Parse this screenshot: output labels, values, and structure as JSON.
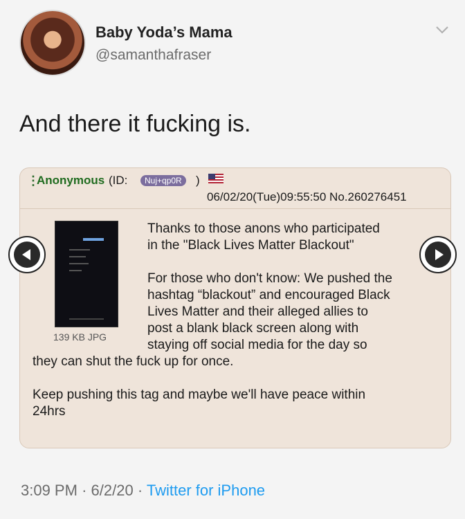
{
  "tweet": {
    "display_name": "Baby Yoda’s Mama",
    "handle": "@samanthafraser",
    "text": "And there it fucking is.",
    "time": "3:09 PM",
    "date": "6/2/20",
    "sep": "·",
    "source": "Twitter for iPhone",
    "chevron_icon": "chevron-down-icon",
    "avatar_icon": "profile-photo"
  },
  "post": {
    "author": "Anonymous",
    "id_label": "(ID:",
    "id_value": "Nuj+qp0R",
    "id_close": ")",
    "flag_icon": "us-flag-icon",
    "timestamp": "06/02/20(Tue)09:55:50 No.260276451",
    "file_info": "139 KB JPG",
    "paragraph1_line1": "Thanks to those anons who participated",
    "paragraph1_line2": "in the \"Black Lives Matter Blackout\"",
    "paragraph2_line1": "For those who don't know: We pushed the",
    "paragraph2_line2": "hashtag “blackout” and encouraged Black",
    "paragraph2_line3": "Lives Matter and their alleged allies to",
    "paragraph2_line4": "post a blank black screen along with",
    "paragraph2_line5": "staying off social media for the day so",
    "paragraph2_line6": "they can shut the fuck up for once.",
    "paragraph3_line1": "Keep pushing this tag and maybe we'll have peace within",
    "paragraph3_line2": "24hrs"
  },
  "nav": {
    "prev_icon": "arrow-left-icon",
    "next_icon": "arrow-right-icon"
  },
  "colors": {
    "link_blue": "#1d9bf0",
    "post_bg": "#efe4da",
    "anon_green": "#1f6b1f",
    "id_pill": "#7c6e9e"
  }
}
